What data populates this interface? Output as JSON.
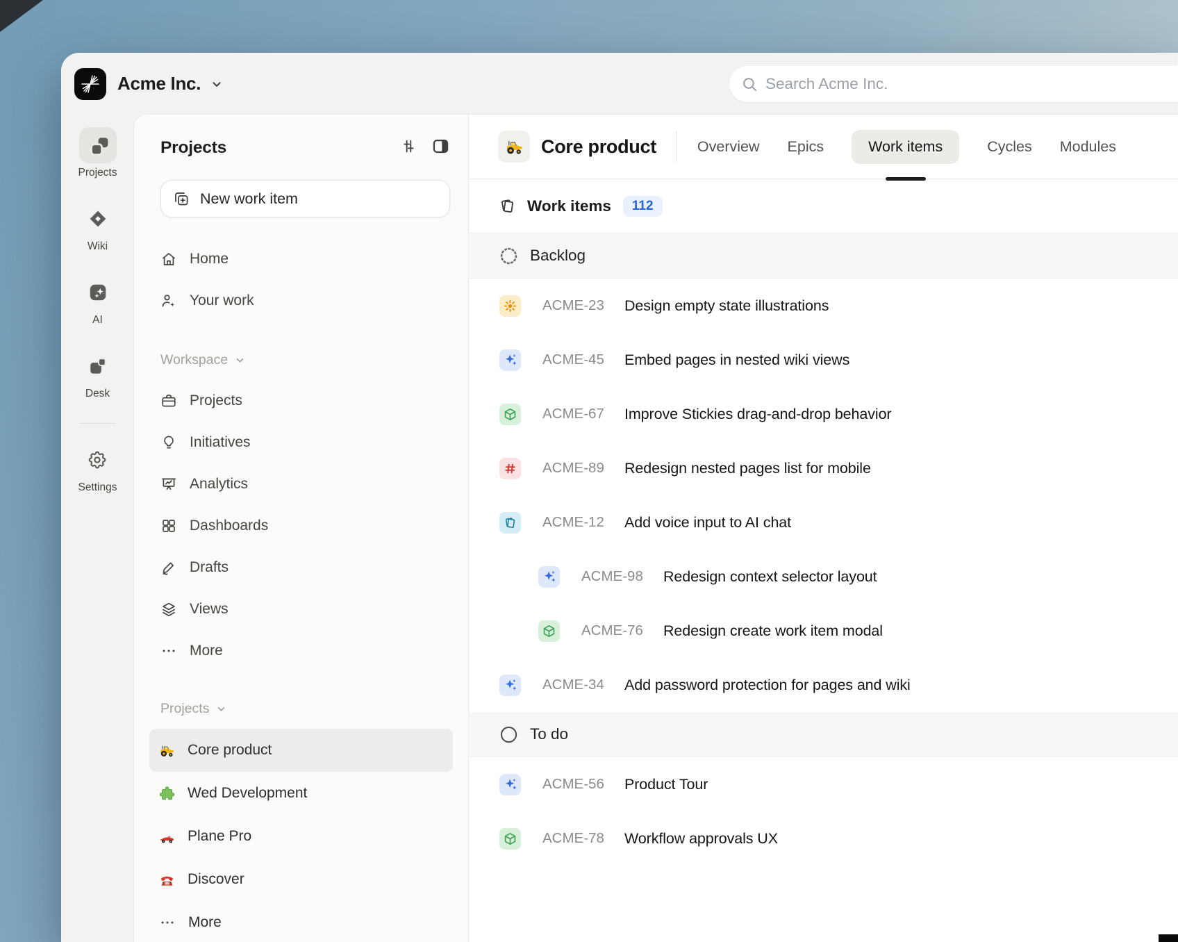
{
  "header": {
    "org_name": "Acme Inc.",
    "search_placeholder": "Search Acme Inc."
  },
  "rail": {
    "items": [
      {
        "label": "Projects",
        "icon": "rail-projects",
        "active": true,
        "divider_before": false
      },
      {
        "label": "Wiki",
        "icon": "rail-wiki",
        "active": false,
        "divider_before": false
      },
      {
        "label": "AI",
        "icon": "rail-ai",
        "active": false,
        "divider_before": false
      },
      {
        "label": "Desk",
        "icon": "rail-desk",
        "active": false,
        "divider_before": false
      },
      {
        "label": "Settings",
        "icon": "rail-settings",
        "active": false,
        "divider_before": true
      }
    ]
  },
  "sidebar": {
    "title": "Projects",
    "new_work_item_label": "New work item",
    "nav": [
      {
        "label": "Home",
        "icon": "home"
      },
      {
        "label": "Your work",
        "icon": "user-sparkle"
      }
    ],
    "workspace_section": {
      "label": "Workspace",
      "items": [
        {
          "label": "Projects",
          "icon": "briefcase"
        },
        {
          "label": "Initiatives",
          "icon": "lightbulb"
        },
        {
          "label": "Analytics",
          "icon": "presentation"
        },
        {
          "label": "Dashboards",
          "icon": "grid"
        },
        {
          "label": "Drafts",
          "icon": "pen"
        },
        {
          "label": "Views",
          "icon": "layers"
        },
        {
          "label": "More",
          "icon": "ellipsis"
        }
      ]
    },
    "projects_section": {
      "label": "Projects",
      "items": [
        {
          "label": "Core product",
          "icon": "tractor",
          "active": true
        },
        {
          "label": "Wed Development",
          "icon": "puzzle",
          "active": false
        },
        {
          "label": "Plane Pro",
          "icon": "racecar",
          "active": false
        },
        {
          "label": "Discover",
          "icon": "telephone",
          "active": false
        },
        {
          "label": "More",
          "icon": "ellipsis",
          "active": false
        }
      ]
    }
  },
  "main": {
    "project_title": "Core product",
    "project_icon": "tractor",
    "tabs": [
      {
        "label": "Overview",
        "active": false
      },
      {
        "label": "Epics",
        "active": false
      },
      {
        "label": "Work items",
        "active": true
      },
      {
        "label": "Cycles",
        "active": false
      },
      {
        "label": "Modules",
        "active": false
      }
    ],
    "work_items_label": "Work items",
    "work_items_count": "112",
    "groups": [
      {
        "name": "Backlog",
        "state_icon": "backlog",
        "items": [
          {
            "id": "ACME-23",
            "title": "Design empty state illustrations",
            "type": "sun",
            "indent": 0
          },
          {
            "id": "ACME-45",
            "title": "Embed pages in nested wiki views",
            "type": "sparkles",
            "indent": 0
          },
          {
            "id": "ACME-67",
            "title": "Improve Stickies drag-and-drop behavior",
            "type": "cube",
            "indent": 0
          },
          {
            "id": "ACME-89",
            "title": "Redesign nested pages list for mobile",
            "type": "hash",
            "indent": 0
          },
          {
            "id": "ACME-12",
            "title": "Add voice input to AI chat",
            "type": "pages",
            "indent": 0
          },
          {
            "id": "ACME-98",
            "title": "Redesign context selector layout",
            "type": "sparkles",
            "indent": 1
          },
          {
            "id": "ACME-76",
            "title": "Redesign create work item modal",
            "type": "cube",
            "indent": 1
          },
          {
            "id": "ACME-34",
            "title": "Add password protection for pages and wiki",
            "type": "sparkles",
            "indent": 0
          }
        ]
      },
      {
        "name": "To do",
        "state_icon": "todo",
        "items": [
          {
            "id": "ACME-56",
            "title": "Product Tour",
            "type": "sparkles",
            "indent": 0
          },
          {
            "id": "ACME-78",
            "title": "Workflow approvals UX",
            "type": "cube",
            "indent": 0
          }
        ]
      }
    ]
  },
  "colors": {
    "badge_text": "#2a63d4",
    "badge_bg": "#e8f1fd",
    "type_sun_bg": "#fbeec6",
    "type_sun_fg": "#ee8d05",
    "type_sparkles_bg": "#dfe8fb",
    "type_sparkles_fg": "#2f6bdf",
    "type_cube_bg": "#d6f0da",
    "type_cube_fg": "#39a050",
    "type_hash_bg": "#fbe2e2",
    "type_hash_fg": "#cb3d3d",
    "type_pages_bg": "#d4edf7",
    "type_pages_fg": "#1f7f9c",
    "window_bg": "#f2f2f0",
    "sidebar_bg": "#fbfbfa",
    "band_bg": "#f6f6f4"
  }
}
